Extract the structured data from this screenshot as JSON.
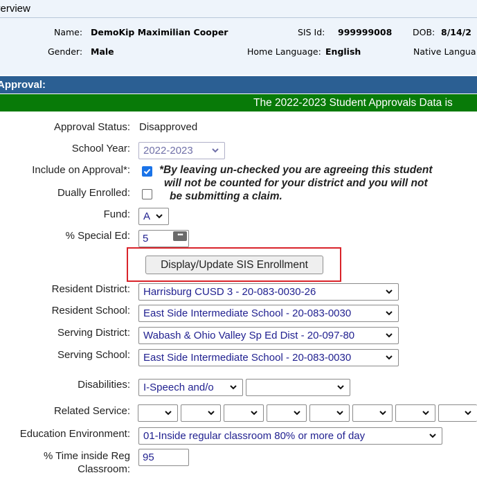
{
  "overview": {
    "title": "verview"
  },
  "student": {
    "name_label": "Name:",
    "name_value": "DemoKip Maximilian Cooper",
    "sis_label": "SIS Id:",
    "sis_value": "999999008",
    "dob_label": "DOB:",
    "dob_value": "8/14/2",
    "gender_label": "Gender:",
    "gender_value": "Male",
    "home_lang_label": "Home Language:",
    "home_lang_value": "English",
    "native_lang_label": "Native Langua"
  },
  "approval": {
    "header": "Approval:",
    "banner": "The 2022-2023 Student Approvals Data is"
  },
  "form": {
    "approval_status_label": "Approval Status:",
    "approval_status_value": "Disapproved",
    "school_year_label": "School Year:",
    "school_year_value": "2022-2023",
    "include_label": "Include on Approval*:",
    "include_checked": true,
    "note_lines": [
      "*By leaving un-checked you are agreeing this student",
      "will not be counted for your district and you will not",
      "be submitting a claim."
    ],
    "dually_label": "Dually Enrolled:",
    "dually_checked": false,
    "fund_label": "Fund:",
    "fund_value": "A",
    "special_ed_label": "% Special Ed:",
    "special_ed_value": "5",
    "password_icon_glyph": "•••",
    "display_button": "Display/Update SIS Enrollment",
    "resident_district_label": "Resident District:",
    "resident_district_value": "Harrisburg CUSD 3 - 20-083-0030-26",
    "resident_school_label": "Resident School:",
    "resident_school_value": "East Side Intermediate School - 20-083-0030",
    "serving_district_label": "Serving District:",
    "serving_district_value": "Wabash & Ohio Valley Sp Ed Dist - 20-097-80",
    "serving_school_label": "Serving School:",
    "serving_school_value": "East Side Intermediate School - 20-083-0030",
    "disabilities_label": "Disabilities:",
    "disability1_value": "I-Speech and/o",
    "disability2_value": "",
    "related_service_label": "Related Service:",
    "related_services": [
      "",
      "",
      "",
      "",
      "",
      "",
      "",
      ""
    ],
    "education_env_label": "Education Environment:",
    "education_env_value": "01-Inside regular classroom 80% or more of day",
    "time_reg_label_line1": "% Time inside Reg",
    "time_reg_label_line2": "Classroom:",
    "time_reg_value": "95"
  },
  "colors": {
    "header_blue": "#2b5f93",
    "banner_green": "#087a08",
    "panel_bg": "#eef4fb",
    "highlight_red": "#d9232a",
    "checkbox_blue": "#1a73e8"
  },
  "icons": {
    "dropdown": "chevron-down-icon",
    "checkmark": "checkmark-icon",
    "password": "password-dots-icon"
  }
}
